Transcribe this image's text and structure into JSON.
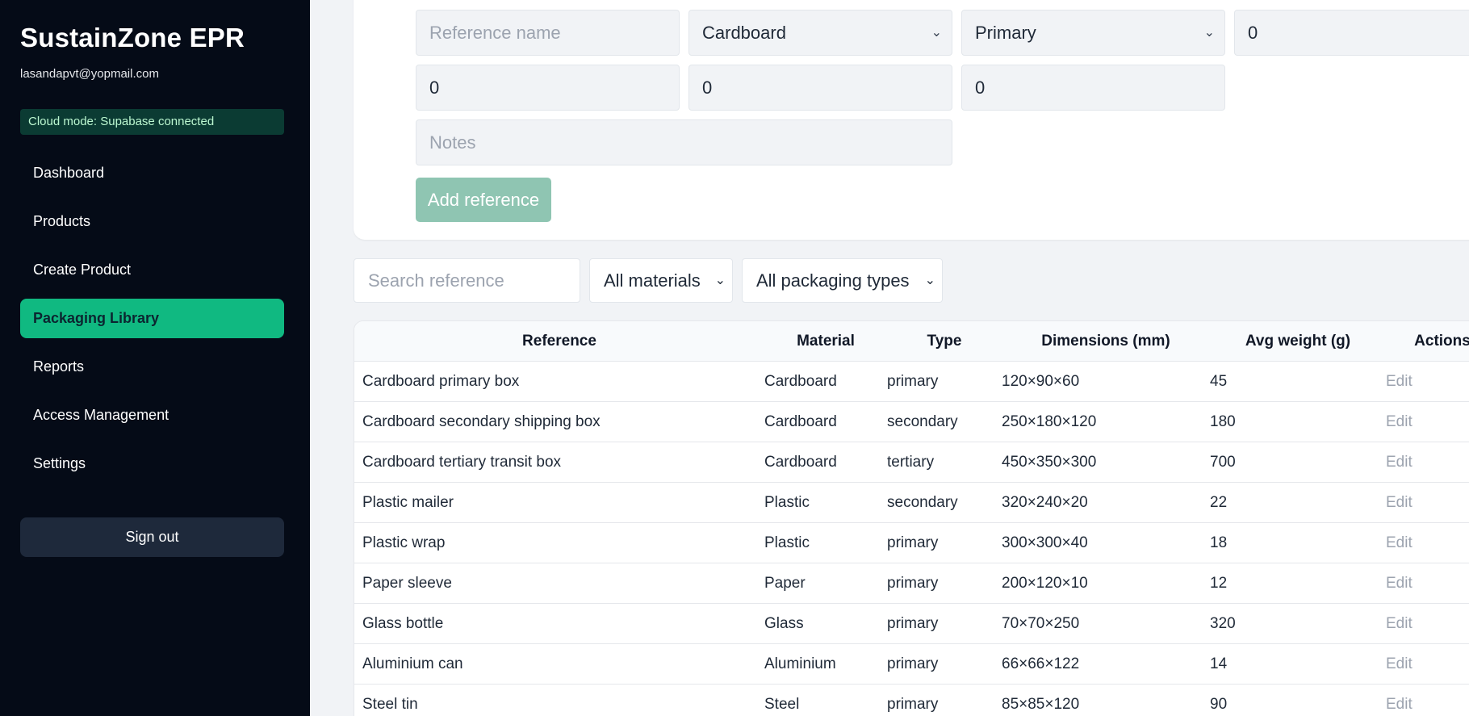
{
  "sidebar": {
    "brand": "SustainZone EPR",
    "email": "lasandapvt@yopmail.com",
    "cloud_status": "Cloud mode: Supabase connected",
    "items": [
      {
        "label": "Dashboard"
      },
      {
        "label": "Products"
      },
      {
        "label": "Create Product"
      },
      {
        "label": "Packaging Library"
      },
      {
        "label": "Reports"
      },
      {
        "label": "Access Management"
      },
      {
        "label": "Settings"
      }
    ],
    "active_item": "Packaging Library",
    "sign_out": "Sign out"
  },
  "form": {
    "reference_placeholder": "Reference name",
    "material_value": "Cardboard",
    "type_value": "Primary",
    "field4_value": "0",
    "field5_value": "0",
    "field6_value": "0",
    "field7_value": "0",
    "notes_placeholder": "Notes",
    "add_button": "Add reference"
  },
  "filters": {
    "search_placeholder": "Search reference",
    "material_filter": "All materials",
    "type_filter": "All packaging types"
  },
  "table": {
    "headers": {
      "reference": "Reference",
      "material": "Material",
      "type": "Type",
      "dimensions": "Dimensions (mm)",
      "weight": "Avg weight (g)",
      "actions": "Actions"
    },
    "rows": [
      {
        "reference": "Cardboard primary box",
        "material": "Cardboard",
        "type": "primary",
        "dimensions": "120×90×60",
        "weight": "45",
        "action": "Edit"
      },
      {
        "reference": "Cardboard secondary shipping box",
        "material": "Cardboard",
        "type": "secondary",
        "dimensions": "250×180×120",
        "weight": "180",
        "action": "Edit"
      },
      {
        "reference": "Cardboard tertiary transit box",
        "material": "Cardboard",
        "type": "tertiary",
        "dimensions": "450×350×300",
        "weight": "700",
        "action": "Edit"
      },
      {
        "reference": "Plastic mailer",
        "material": "Plastic",
        "type": "secondary",
        "dimensions": "320×240×20",
        "weight": "22",
        "action": "Edit"
      },
      {
        "reference": "Plastic wrap",
        "material": "Plastic",
        "type": "primary",
        "dimensions": "300×300×40",
        "weight": "18",
        "action": "Edit"
      },
      {
        "reference": "Paper sleeve",
        "material": "Paper",
        "type": "primary",
        "dimensions": "200×120×10",
        "weight": "12",
        "action": "Edit"
      },
      {
        "reference": "Glass bottle",
        "material": "Glass",
        "type": "primary",
        "dimensions": "70×70×250",
        "weight": "320",
        "action": "Edit"
      },
      {
        "reference": "Aluminium can",
        "material": "Aluminium",
        "type": "primary",
        "dimensions": "66×66×122",
        "weight": "14",
        "action": "Edit"
      },
      {
        "reference": "Steel tin",
        "material": "Steel",
        "type": "primary",
        "dimensions": "85×85×120",
        "weight": "90",
        "action": "Edit"
      }
    ]
  }
}
